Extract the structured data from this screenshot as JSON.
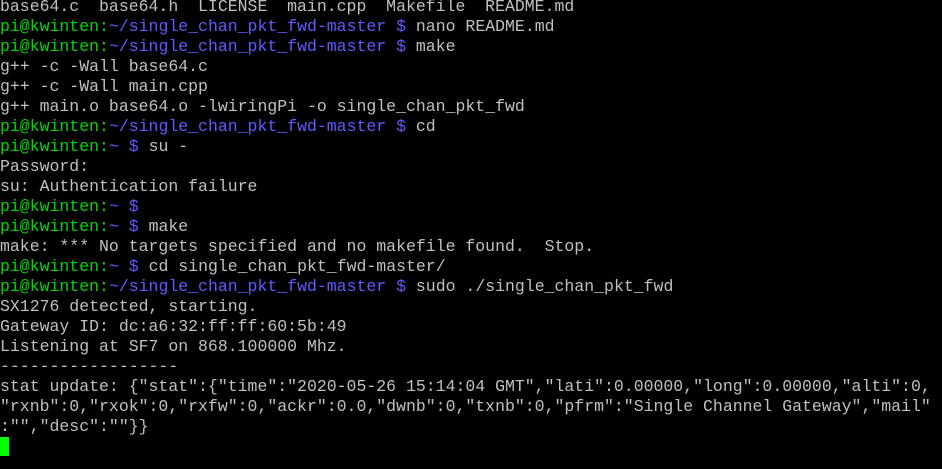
{
  "terminal": {
    "colors": {
      "background": "#000000",
      "text": "#c0c0c0",
      "prompt_user": "#00d700",
      "prompt_path": "#5c5cff",
      "cursor": "#00ff00"
    },
    "lines": [
      {
        "kind": "output",
        "text": "base64.c  base64.h  LICENSE  main.cpp  Makefile  README.md"
      },
      {
        "kind": "prompt",
        "user": "pi@kwinten",
        "sep": ":",
        "path": "~/single_chan_pkt_fwd-master",
        "sym": " $ ",
        "cmd": "nano README.md"
      },
      {
        "kind": "prompt",
        "user": "pi@kwinten",
        "sep": ":",
        "path": "~/single_chan_pkt_fwd-master",
        "sym": " $ ",
        "cmd": "make"
      },
      {
        "kind": "output",
        "text": "g++ -c -Wall base64.c"
      },
      {
        "kind": "output",
        "text": "g++ -c -Wall main.cpp"
      },
      {
        "kind": "output",
        "text": "g++ main.o base64.o -lwiringPi -o single_chan_pkt_fwd"
      },
      {
        "kind": "prompt",
        "user": "pi@kwinten",
        "sep": ":",
        "path": "~/single_chan_pkt_fwd-master",
        "sym": " $ ",
        "cmd": "cd"
      },
      {
        "kind": "prompt",
        "user": "pi@kwinten",
        "sep": ":",
        "path": "~",
        "sym": " $ ",
        "cmd": "su -"
      },
      {
        "kind": "output",
        "text": "Password:"
      },
      {
        "kind": "output",
        "text": "su: Authentication failure"
      },
      {
        "kind": "prompt",
        "user": "pi@kwinten",
        "sep": ":",
        "path": "~",
        "sym": " $ ",
        "cmd": ""
      },
      {
        "kind": "prompt",
        "user": "pi@kwinten",
        "sep": ":",
        "path": "~",
        "sym": " $ ",
        "cmd": "make"
      },
      {
        "kind": "output",
        "text": "make: *** No targets specified and no makefile found.  Stop."
      },
      {
        "kind": "prompt",
        "user": "pi@kwinten",
        "sep": ":",
        "path": "~",
        "sym": " $ ",
        "cmd": "cd single_chan_pkt_fwd-master/"
      },
      {
        "kind": "prompt",
        "user": "pi@kwinten",
        "sep": ":",
        "path": "~/single_chan_pkt_fwd-master",
        "sym": " $ ",
        "cmd": "sudo ./single_chan_pkt_fwd"
      },
      {
        "kind": "output",
        "text": "SX1276 detected, starting."
      },
      {
        "kind": "output",
        "text": "Gateway ID: dc:a6:32:ff:ff:60:5b:49"
      },
      {
        "kind": "output",
        "text": "Listening at SF7 on 868.100000 Mhz."
      },
      {
        "kind": "output",
        "text": "------------------"
      },
      {
        "kind": "output",
        "text": "stat update: {\"stat\":{\"time\":\"2020-05-26 15:14:04 GMT\",\"lati\":0.00000,\"long\":0.00000,\"alti\":0,"
      },
      {
        "kind": "output",
        "text": "\"rxnb\":0,\"rxok\":0,\"rxfw\":0,\"ackr\":0.0,\"dwnb\":0,\"txnb\":0,\"pfrm\":\"Single Channel Gateway\",\"mail\""
      },
      {
        "kind": "output",
        "text": ":\"\",\"desc\":\"\"}}"
      },
      {
        "kind": "cursor"
      }
    ]
  }
}
